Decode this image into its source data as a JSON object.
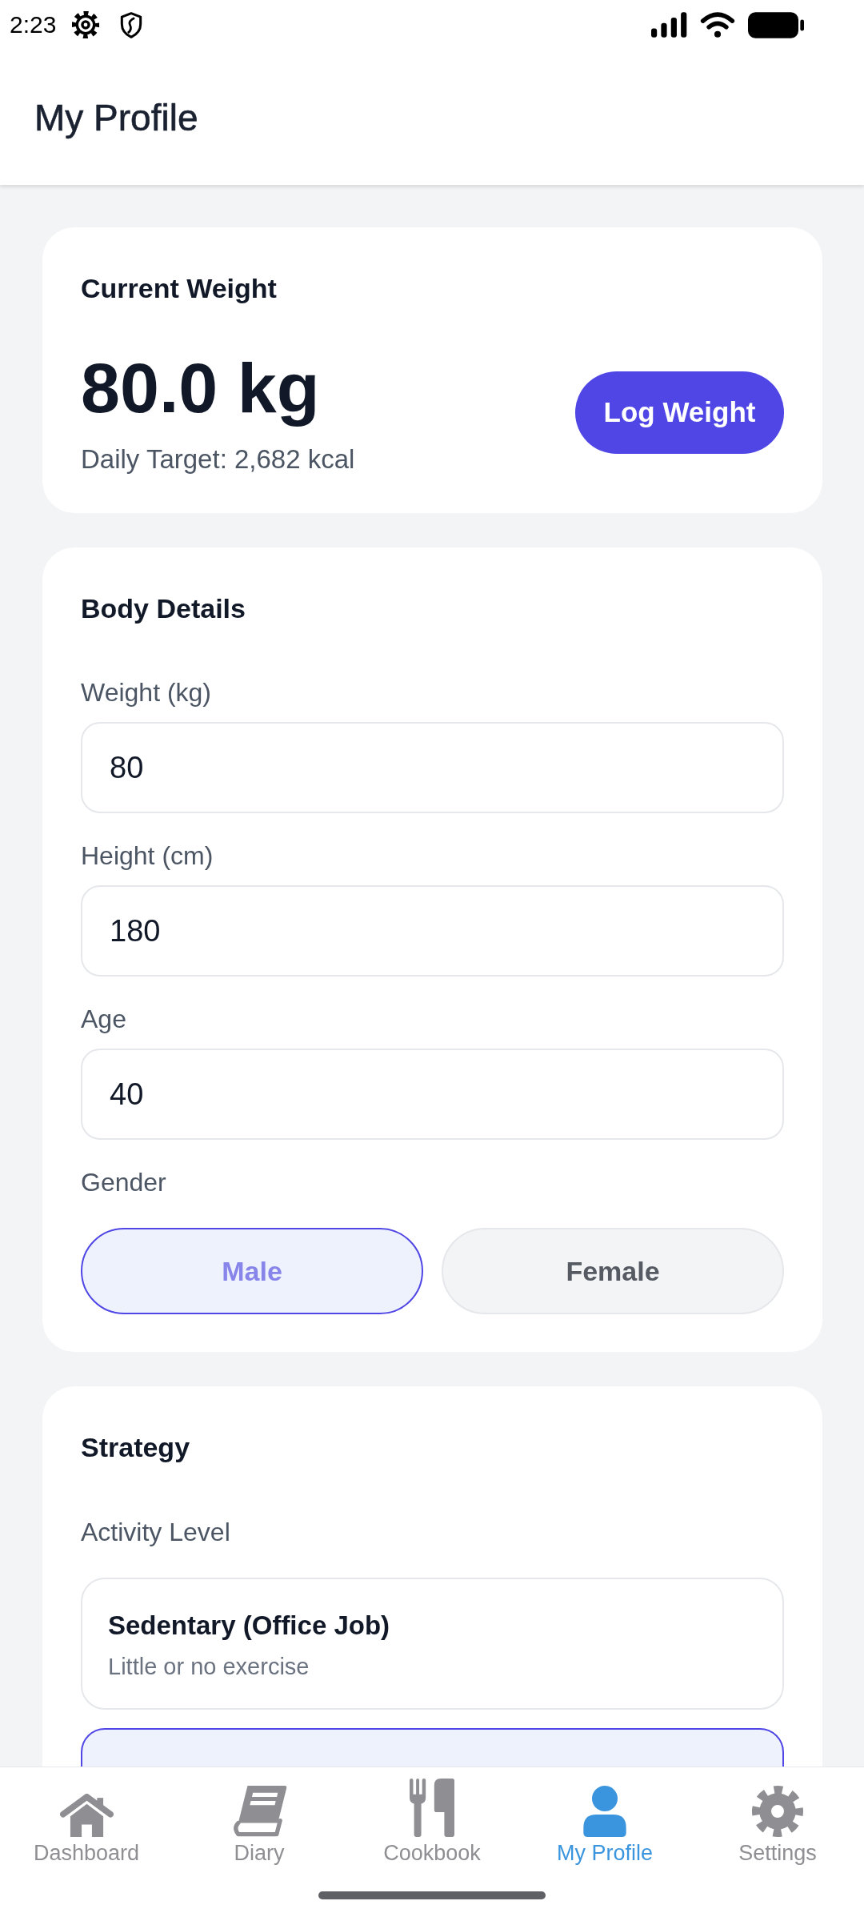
{
  "status_bar": {
    "time": "2:23"
  },
  "header": {
    "title": "My Profile"
  },
  "current_weight": {
    "title": "Current Weight",
    "value": "80.0 kg",
    "daily_target": "Daily Target: 2,682 kcal",
    "button": "Log Weight"
  },
  "body_details": {
    "title": "Body Details",
    "fields": [
      {
        "label": "Weight (kg)",
        "value": "80"
      },
      {
        "label": "Height (cm)",
        "value": "180"
      },
      {
        "label": "Age",
        "value": "40"
      }
    ],
    "gender": {
      "label": "Gender",
      "options": [
        {
          "label": "Male",
          "selected": true
        },
        {
          "label": "Female",
          "selected": false
        }
      ]
    }
  },
  "strategy": {
    "title": "Strategy",
    "activity_level": {
      "label": "Activity Level",
      "options": [
        {
          "title": "Sedentary (Office Job)",
          "description": "Little or no exercise",
          "selected": false
        },
        {
          "selected": true
        }
      ]
    }
  },
  "bottom_nav": [
    {
      "label": "Dashboard",
      "selected": false
    },
    {
      "label": "Diary",
      "selected": false
    },
    {
      "label": "Cookbook",
      "selected": false
    },
    {
      "label": "My Profile",
      "selected": true
    },
    {
      "label": "Settings",
      "selected": false
    }
  ]
}
